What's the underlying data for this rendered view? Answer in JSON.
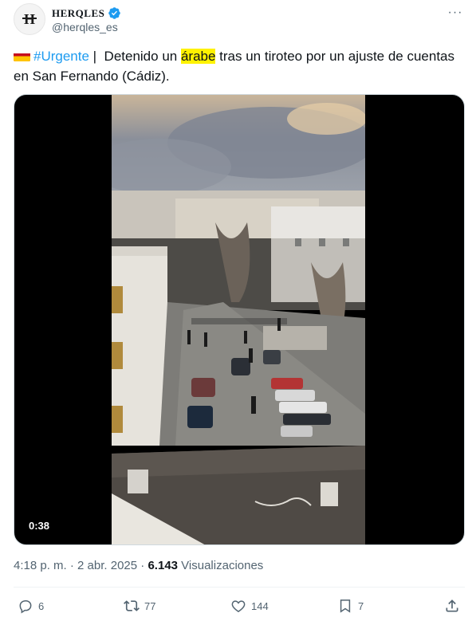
{
  "author": {
    "display_name": "HERQLES",
    "handle": "@herqles_es",
    "avatar_icon": "herqles-logo"
  },
  "tweet": {
    "hashtag": "#Urgente",
    "separator": "|",
    "text_before": "  Detenido un ",
    "highlighted_word": "árabe",
    "text_after": " tras un tiroteo por un ajuste de cuentas en San Fernando (Cádiz).",
    "flag_icon": "spain-flag-icon"
  },
  "media": {
    "type": "video",
    "duration": "0:38"
  },
  "meta": {
    "time": "4:18 p. m.",
    "dot": " · ",
    "date": "2 abr. 2025",
    "dot2": " · ",
    "views_count": "6.143",
    "views_label": " Visualizaciones"
  },
  "actions": {
    "replies": "6",
    "reposts": "77",
    "likes": "144",
    "bookmarks": "7"
  },
  "colors": {
    "accent": "#1d9bf0",
    "text": "#0f1419",
    "muted": "#536471",
    "highlight": "#fff200"
  }
}
